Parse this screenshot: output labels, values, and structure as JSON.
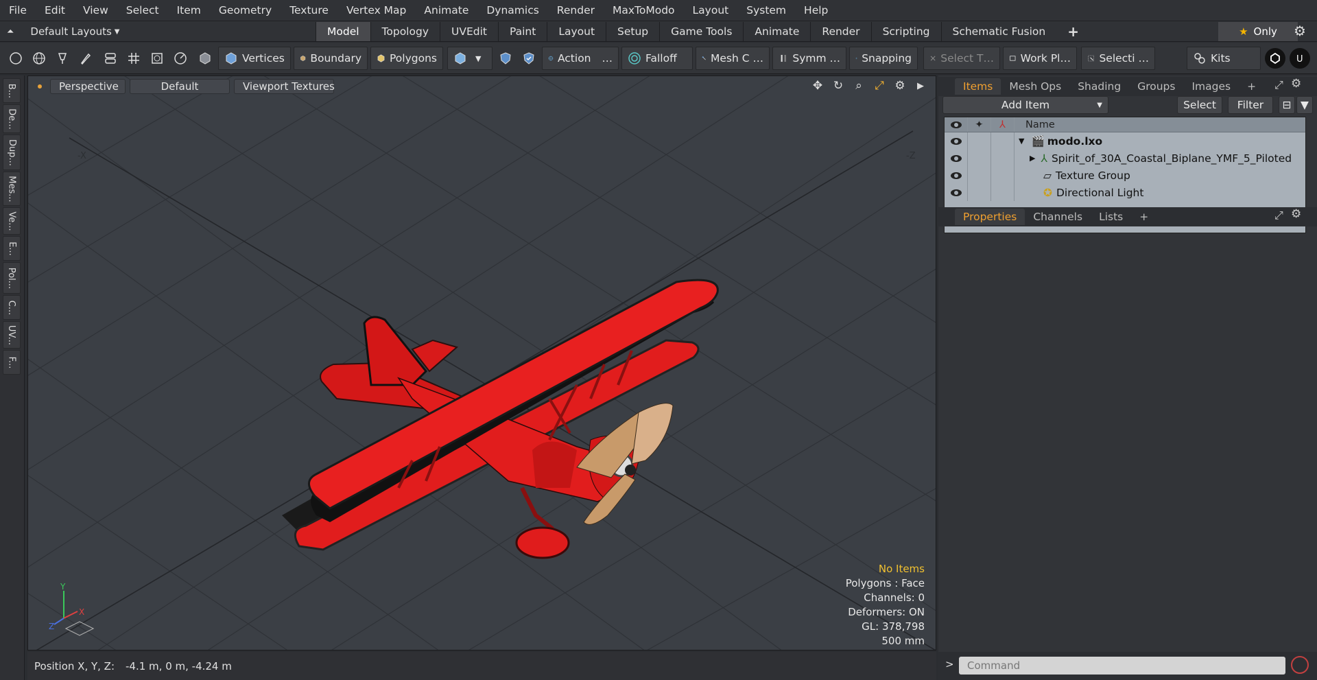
{
  "menu": [
    "File",
    "Edit",
    "View",
    "Select",
    "Item",
    "Geometry",
    "Texture",
    "Vertex Map",
    "Animate",
    "Dynamics",
    "Render",
    "MaxToModo",
    "Layout",
    "System",
    "Help"
  ],
  "layout_selector": "Default Layouts",
  "tabs": [
    {
      "label": "Model",
      "active": true
    },
    {
      "label": "Topology",
      "active": false
    },
    {
      "label": "UVEdit",
      "active": false
    },
    {
      "label": "Paint",
      "active": false
    },
    {
      "label": "Layout",
      "active": false
    },
    {
      "label": "Setup",
      "active": false
    },
    {
      "label": "Game Tools",
      "active": false
    },
    {
      "label": "Animate",
      "active": false
    },
    {
      "label": "Render",
      "active": false
    },
    {
      "label": "Scripting",
      "active": false
    },
    {
      "label": "Schematic Fusion",
      "active": false
    }
  ],
  "tab_add": "+",
  "only_label": "Only",
  "toolbar": {
    "vertices": "Vertices",
    "boundary": "Boundary",
    "polygons": "Polygons",
    "action": "Action",
    "action_more": "…",
    "falloff": "Falloff",
    "mesh_c": "Mesh C …",
    "symm": "Symm …",
    "snapping": "Snapping",
    "select_t": "Select T…",
    "work_pl": "Work Pl…",
    "selecti": "Selecti …",
    "kits": "Kits"
  },
  "left_tabs": [
    "B...",
    "De...",
    "Dup...",
    "Mes...",
    "Ve...",
    "E...",
    "Pol...",
    "C...",
    "UV...",
    "F..."
  ],
  "viewport": {
    "perspective": "Perspective",
    "default": "Default",
    "viewport_textures": "Viewport Textures",
    "axis_x": "-X",
    "axis_z": "-Z",
    "stats": {
      "no_items": "No Items",
      "polygons": "Polygons : Face",
      "channels": "Channels: 0",
      "deformers": "Deformers: ON",
      "gl": "GL: 378,798",
      "scale": "500 mm"
    },
    "gizmo": {
      "x": "X",
      "y": "Y",
      "z": "Z"
    }
  },
  "status": {
    "label": "Position X, Y, Z:",
    "value": "-4.1 m, 0 m, -4.24 m"
  },
  "items_panel": {
    "tabs": [
      "Items",
      "Mesh Ops",
      "Shading",
      "Groups",
      "Images"
    ],
    "add_item": "Add Item",
    "select": "Select",
    "filter": "Filter",
    "name_header": "Name",
    "rows": [
      {
        "name": "modo.lxo",
        "bold": true
      },
      {
        "name": "Spirit_of_30A_Coastal_Biplane_YMF_5_Piloted",
        "bold": false
      },
      {
        "name": "Texture Group",
        "bold": false
      },
      {
        "name": "Directional Light",
        "bold": false
      }
    ]
  },
  "properties_panel": {
    "tabs": [
      "Properties",
      "Channels",
      "Lists"
    ]
  },
  "command": {
    "placeholder": "Command",
    "prompt": ">"
  },
  "colors": {
    "accent": "#f0a030",
    "plane_red": "#e11d1d",
    "viewport_bg": "#3b3f45"
  }
}
